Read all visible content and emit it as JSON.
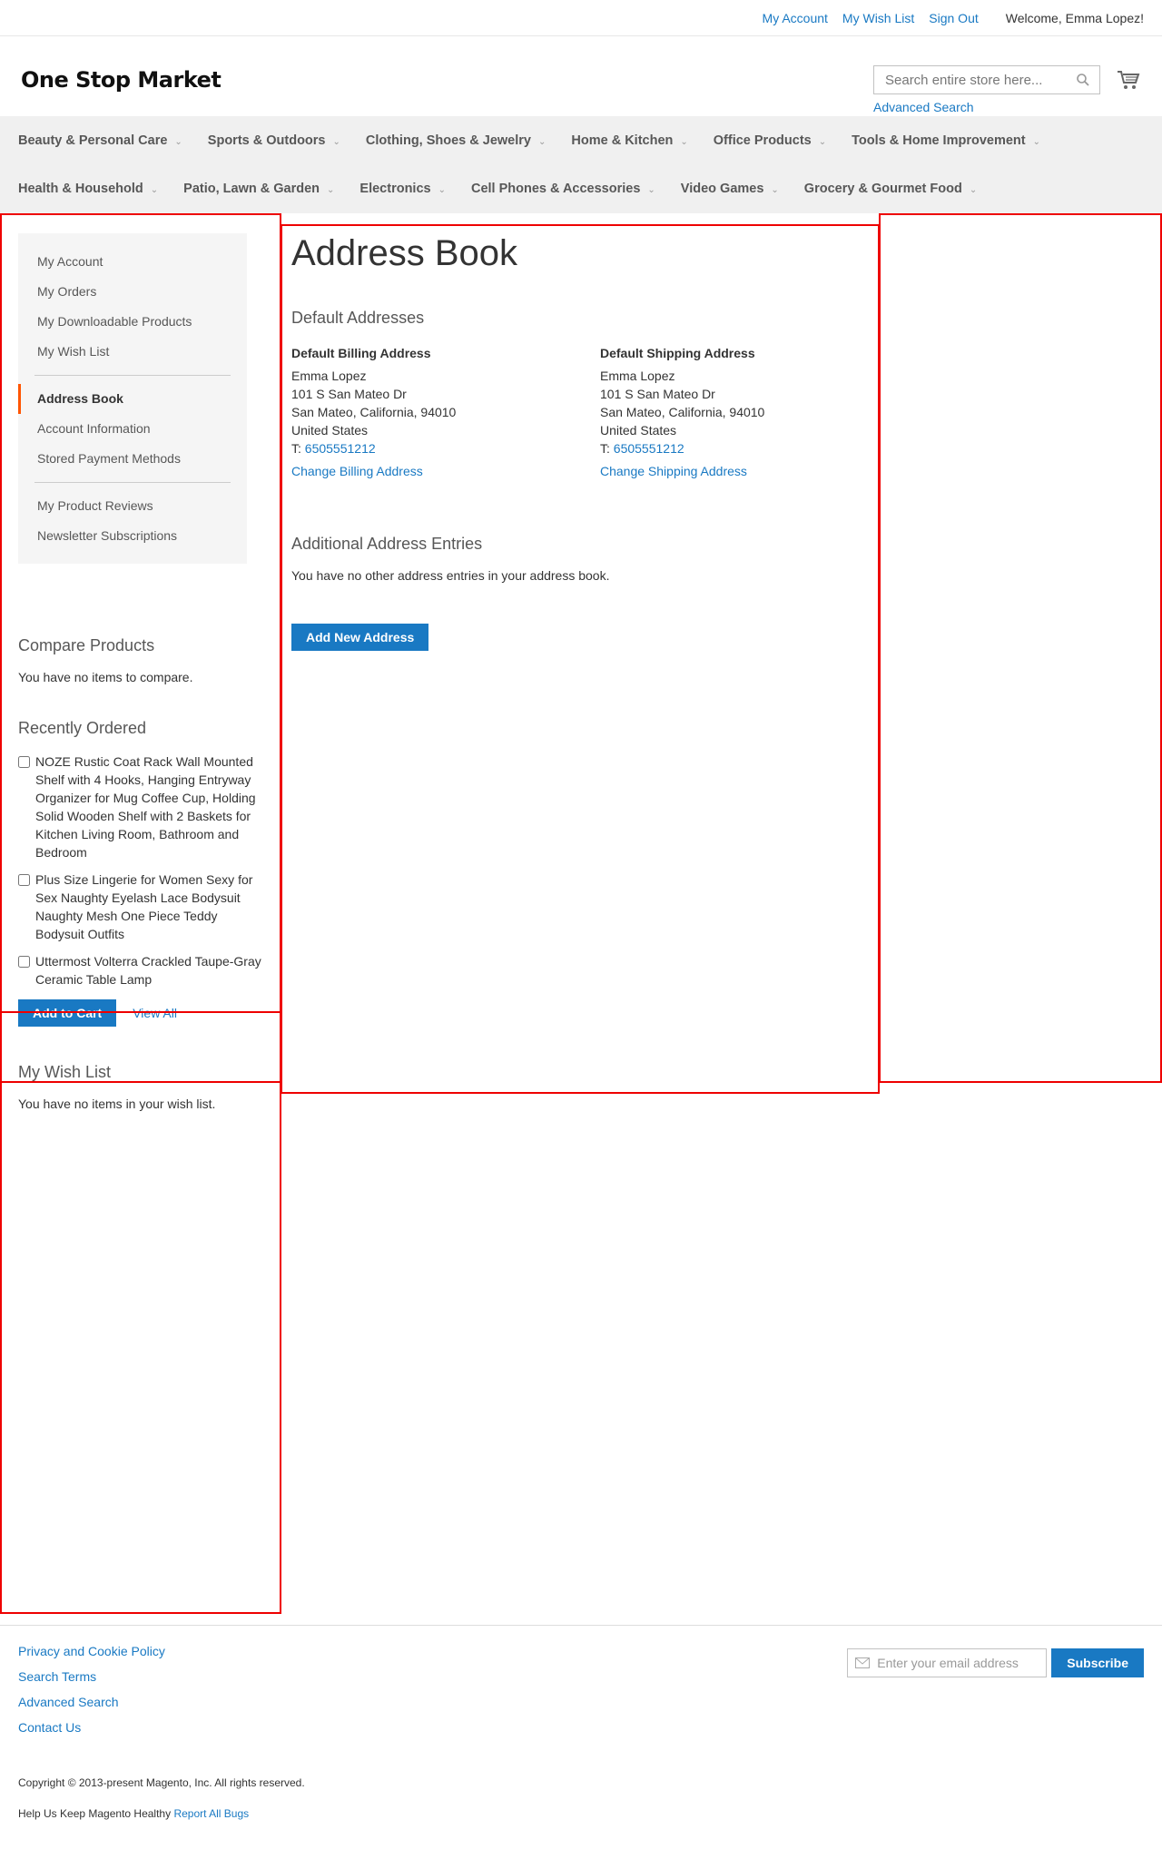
{
  "top_links": {
    "my_account": "My Account",
    "my_wish_list": "My Wish List",
    "sign_out": "Sign Out",
    "welcome": "Welcome, Emma Lopez!"
  },
  "header": {
    "logo": "One Stop Market",
    "search_placeholder": "Search entire store here...",
    "advanced_search": "Advanced Search",
    "cart_icon": "cart-icon"
  },
  "nav": {
    "row1": [
      "Beauty & Personal Care",
      "Sports & Outdoors",
      "Clothing, Shoes & Jewelry",
      "Home & Kitchen",
      "Office Products",
      "Tools & Home Improvement"
    ],
    "row2": [
      "Health & Household",
      "Patio, Lawn & Garden",
      "Electronics",
      "Cell Phones & Accessories",
      "Video Games",
      "Grocery & Gourmet Food"
    ]
  },
  "account_nav": {
    "group1": [
      "My Account",
      "My Orders",
      "My Downloadable Products",
      "My Wish List"
    ],
    "group2": [
      "Address Book",
      "Account Information",
      "Stored Payment Methods"
    ],
    "group3": [
      "My Product Reviews",
      "Newsletter Subscriptions"
    ],
    "active": "Address Book"
  },
  "compare": {
    "title": "Compare Products",
    "empty": "You have no items to compare."
  },
  "recently_ordered": {
    "title": "Recently Ordered",
    "items": [
      "NOZE Rustic Coat Rack Wall Mounted Shelf with 4 Hooks, Hanging Entryway Organizer for Mug Coffee Cup, Holding Solid Wooden Shelf with 2 Baskets for Kitchen Living Room, Bathroom and Bedroom",
      "Plus Size Lingerie for Women Sexy for Sex Naughty Eyelash Lace Bodysuit Naughty Mesh One Piece Teddy Bodysuit Outfits",
      "Uttermost Volterra Crackled Taupe-Gray Ceramic Table Lamp"
    ],
    "add_to_cart": "Add to Cart",
    "view_all": "View All"
  },
  "wishlist": {
    "title": "My Wish List",
    "empty": "You have no items in your wish list."
  },
  "main": {
    "title": "Address Book",
    "default_addresses_title": "Default Addresses",
    "billing": {
      "title": "Default Billing Address",
      "name": "Emma Lopez",
      "street": "101 S San Mateo Dr",
      "city": "San Mateo, California, 94010",
      "country": "United States",
      "phone_prefix": "T: ",
      "phone": "6505551212",
      "action": "Change Billing Address"
    },
    "shipping": {
      "title": "Default Shipping Address",
      "name": "Emma Lopez",
      "street": "101 S San Mateo Dr",
      "city": "San Mateo, California, 94010",
      "country": "United States",
      "phone_prefix": "T: ",
      "phone": "6505551212",
      "action": "Change Shipping Address"
    },
    "additional_title": "Additional Address Entries",
    "additional_empty": "You have no other address entries in your address book.",
    "add_new": "Add New Address"
  },
  "footer": {
    "links": [
      "Privacy and Cookie Policy",
      "Search Terms",
      "Advanced Search",
      "Contact Us"
    ],
    "newsletter_placeholder": "Enter your email address",
    "subscribe": "Subscribe",
    "copyright": "Copyright © 2013-present Magento, Inc. All rights reserved.",
    "bugs_text": "Help Us Keep Magento Healthy",
    "bugs_link": "Report All Bugs"
  },
  "colors": {
    "link": "#1979c3",
    "active_accent": "#ff5501",
    "annotation": "#ee0000"
  }
}
